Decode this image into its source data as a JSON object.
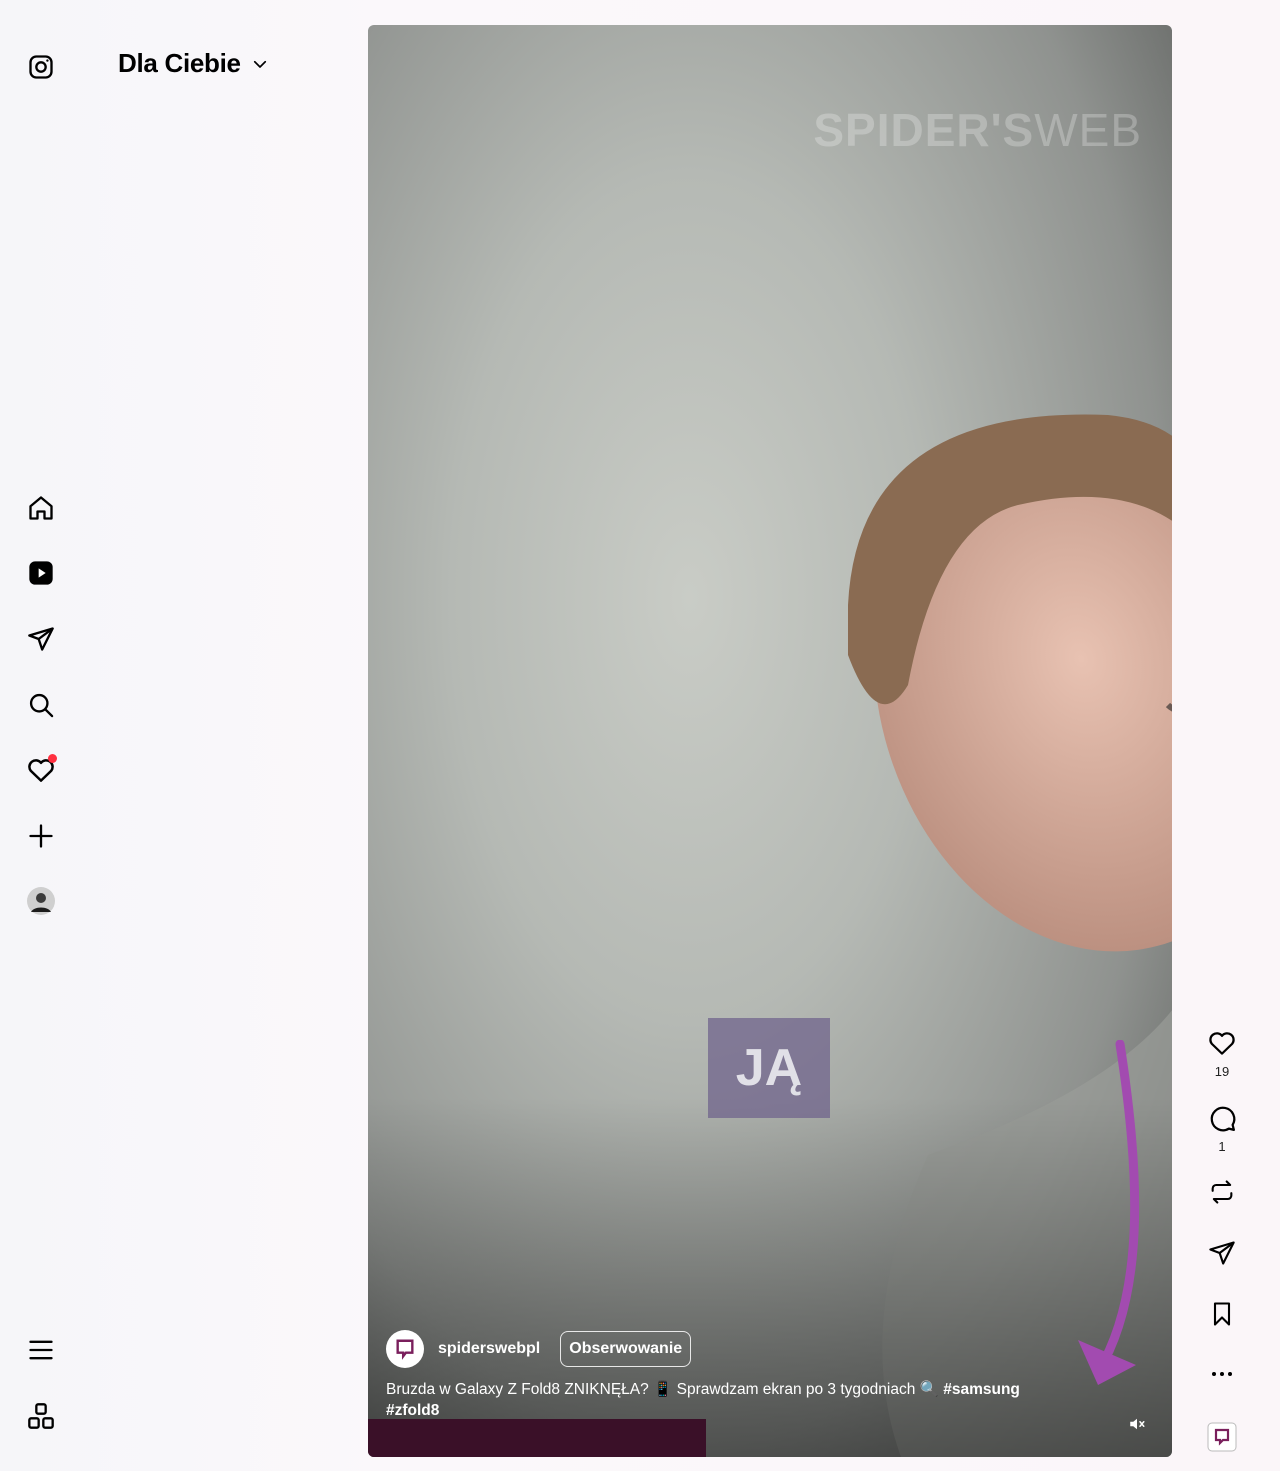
{
  "header": {
    "title": "Dla Ciebie"
  },
  "sidebar": {
    "items": [
      {
        "name": "instagram-logo-icon"
      },
      {
        "name": "home-icon"
      },
      {
        "name": "reels-icon"
      },
      {
        "name": "messages-icon"
      },
      {
        "name": "search-icon"
      },
      {
        "name": "notifications-icon",
        "has_badge": true
      },
      {
        "name": "create-icon"
      },
      {
        "name": "profile-avatar"
      },
      {
        "name": "menu-icon"
      },
      {
        "name": "more-apps-icon"
      }
    ]
  },
  "video": {
    "watermark_bold": "SPIDER'S",
    "watermark_thin": "WEB",
    "overlay_text": "JĄ",
    "author": "spiderswebpl",
    "follow_label": "Obserwowanie",
    "caption_text": "Bruzda w Galaxy Z Fold8 ZNIKNĘŁA? 📱 Sprawdzam ekran po 3 tygodniach 🔍 ",
    "caption_tag1": "#samsung",
    "caption_tag2": "#zfold8",
    "progress": 0.42
  },
  "actions": {
    "likes": "19",
    "comments": "1"
  },
  "colors": {
    "accent": "#a24bb0",
    "notification_dot": "#ff3040",
    "brand_square": "#7a1f5c"
  }
}
